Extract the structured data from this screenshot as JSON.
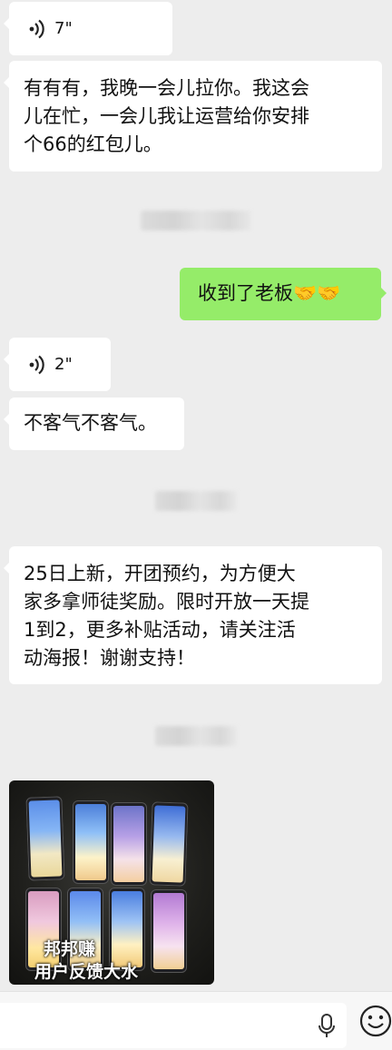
{
  "messages": [
    {
      "type": "voice",
      "side": "in",
      "duration": "7\""
    },
    {
      "type": "text",
      "side": "in",
      "lines": [
        "有有有，我晚一会儿拉你。我这会",
        "儿在忙，一会儿我让运营给你安排",
        "个66的红包儿。"
      ]
    },
    {
      "type": "text",
      "side": "out",
      "text": "收到了老板🤝🤝"
    },
    {
      "type": "voice",
      "side": "in",
      "duration": "2\""
    },
    {
      "type": "text",
      "side": "in",
      "text": "不客气不客气。"
    },
    {
      "type": "text",
      "side": "in",
      "lines": [
        "25日上新，开团预约，为方便大",
        "家多拿师徒奖励。限时开放一天提",
        "1到2，更多补贴活动，请关注活",
        "动海报！谢谢支持！"
      ]
    },
    {
      "type": "image",
      "side": "in",
      "caption_lines": [
        "邦邦赚",
        "用户反馈大水"
      ]
    }
  ],
  "input_bar": {
    "mic_icon": "microphone-icon",
    "emoji_icon": "emoji-icon"
  },
  "colors": {
    "background": "#ededed",
    "incoming_bubble": "#ffffff",
    "outgoing_bubble": "#95ec69"
  }
}
